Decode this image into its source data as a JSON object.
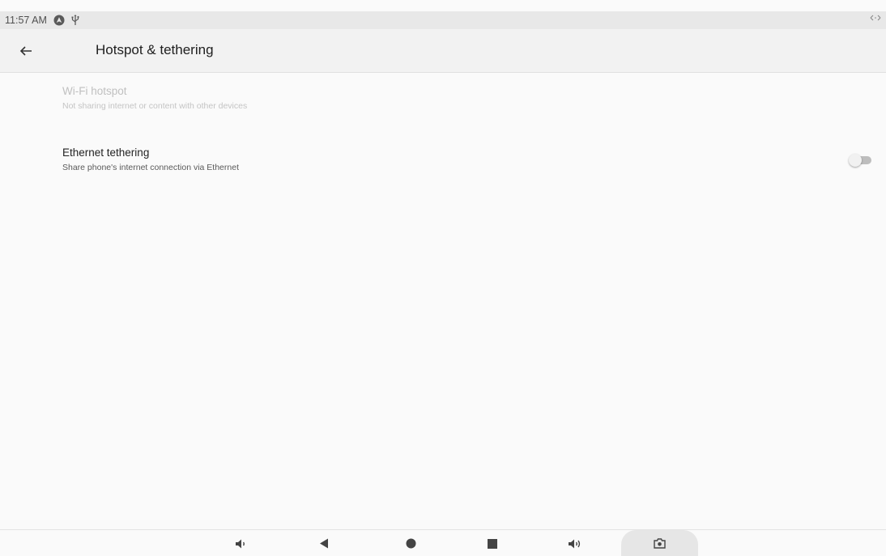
{
  "status_bar": {
    "time": "11:57 AM",
    "icons": [
      "location-icon",
      "usb-icon"
    ],
    "right_icon": "data-transfer-icon"
  },
  "app_bar": {
    "title": "Hotspot & tethering",
    "back_icon": "arrow-left-icon"
  },
  "preferences": [
    {
      "title": "Wi-Fi hotspot",
      "summary": "Not sharing internet or content with other devices",
      "enabled": false
    },
    {
      "title": "Ethernet tethering",
      "summary": "Share phone's internet connection via Ethernet",
      "enabled": true,
      "switch_on": false
    }
  ],
  "nav_bar": {
    "buttons": [
      "volume-down-icon",
      "back-icon",
      "home-icon",
      "recents-icon",
      "volume-up-icon",
      "screenshot-icon"
    ]
  },
  "colors": {
    "background": "#fafafa",
    "app_bar": "#f2f2f2",
    "status_bar": "#e8e8e8",
    "disabled_text": "#c0c0c0"
  }
}
